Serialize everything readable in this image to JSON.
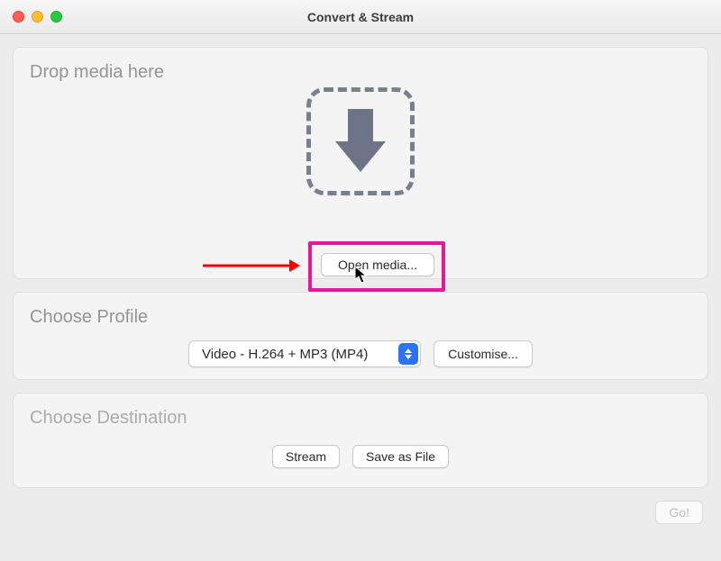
{
  "window": {
    "title": "Convert & Stream"
  },
  "drop": {
    "title": "Drop media here",
    "open_media_label": "Open media..."
  },
  "profile": {
    "title": "Choose Profile",
    "selected": "Video - H.264 + MP3 (MP4)",
    "customise_label": "Customise..."
  },
  "destination": {
    "title": "Choose Destination",
    "stream_label": "Stream",
    "save_label": "Save as File"
  },
  "footer": {
    "go_label": "Go!"
  }
}
